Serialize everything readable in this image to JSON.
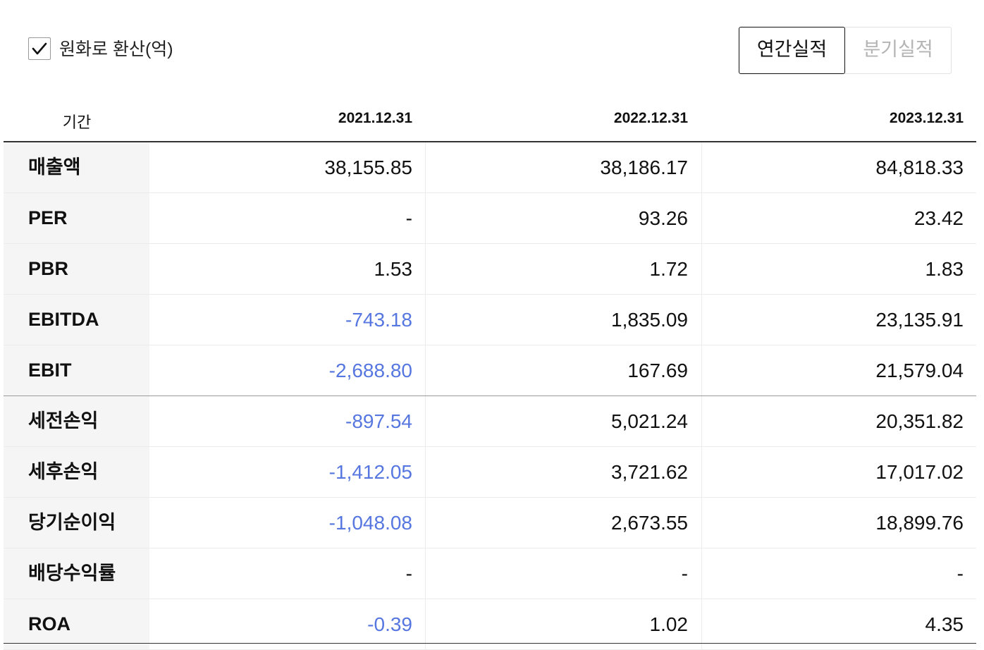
{
  "controls": {
    "convert_label": "원화로 환산(억)",
    "convert_checked": true,
    "tabs": [
      {
        "label": "연간실적",
        "active": true
      },
      {
        "label": "분기실적",
        "active": false
      }
    ]
  },
  "table": {
    "period_label": "기간",
    "columns": [
      "2021.12.31",
      "2022.12.31",
      "2023.12.31"
    ],
    "rows": [
      {
        "label": "매출액",
        "values": [
          "38,155.85",
          "38,186.17",
          "84,818.33"
        ]
      },
      {
        "label": "PER",
        "values": [
          "-",
          "93.26",
          "23.42"
        ]
      },
      {
        "label": "PBR",
        "values": [
          "1.53",
          "1.72",
          "1.83"
        ]
      },
      {
        "label": "EBITDA",
        "values": [
          "-743.18",
          "1,835.09",
          "23,135.91"
        ]
      },
      {
        "label": "EBIT",
        "values": [
          "-2,688.80",
          "167.69",
          "21,579.04"
        ]
      },
      {
        "label": "세전손익",
        "values": [
          "-897.54",
          "5,021.24",
          "20,351.82"
        ]
      },
      {
        "label": "세후손익",
        "values": [
          "-1,412.05",
          "3,721.62",
          "17,017.02"
        ]
      },
      {
        "label": "당기순이익",
        "values": [
          "-1,048.08",
          "2,673.55",
          "18,899.76"
        ]
      },
      {
        "label": "배당수익률",
        "values": [
          "-",
          "-",
          "-"
        ]
      },
      {
        "label": "ROA",
        "values": [
          "-0.39",
          "1.02",
          "4.35"
        ]
      }
    ]
  },
  "colors": {
    "negative": "#5676e0",
    "text": "#111111",
    "label_bg": "#f5f5f5"
  }
}
